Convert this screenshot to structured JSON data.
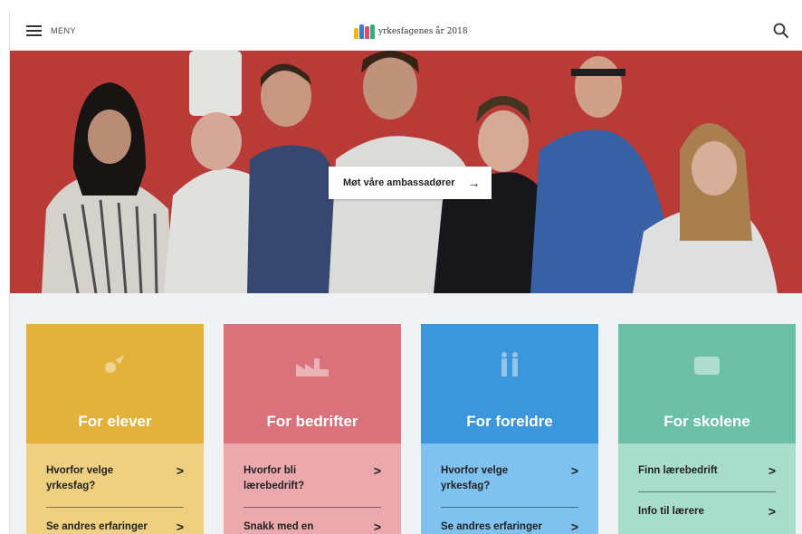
{
  "header": {
    "menu_label": "MENY",
    "logo_text": "yrkesfagenes år 2018",
    "logo_figure_colors": [
      "#f2b705",
      "#3a7bd5",
      "#e04a6b",
      "#2db37a"
    ]
  },
  "hero": {
    "background": "#c8403d",
    "cta_label": "Møt våre ambassadører",
    "cta_arrow": "→"
  },
  "cards": [
    {
      "title": "For elever",
      "icon": "elever-icon",
      "head_color": "#e3b23b",
      "body_color": "#efd080",
      "links": [
        {
          "label_lines": [
            "Hvorfor velge",
            "yrkesfag?"
          ],
          "chevron": ">"
        },
        {
          "label_lines": [
            "Se andres erfaringer"
          ],
          "chevron": ">"
        }
      ]
    },
    {
      "title": "For bedrifter",
      "icon": "factory-icon",
      "head_color": "#d9727b",
      "body_color": "#eba9ad",
      "links": [
        {
          "label_lines": [
            "Hvorfor bli",
            "lærebedrift?"
          ],
          "chevron": ">"
        },
        {
          "label_lines": [
            "Snakk med en"
          ],
          "chevron": ">"
        }
      ]
    },
    {
      "title": "For foreldre",
      "icon": "parents-icon",
      "head_color": "#3b96dc",
      "body_color": "#7fc2ef",
      "links": [
        {
          "label_lines": [
            "Hvorfor velge",
            "yrkesfag?"
          ],
          "chevron": ">"
        },
        {
          "label_lines": [
            "Se andres erfaringer"
          ],
          "chevron": ">"
        }
      ]
    },
    {
      "title": "For skolene",
      "icon": "school-icon",
      "head_color": "#6cc0a7",
      "body_color": "#a8dccb",
      "links": [
        {
          "label_lines": [
            "Finn lærebedrift"
          ],
          "chevron": ">"
        },
        {
          "label_lines": [
            "Info til lærere"
          ],
          "chevron": ">"
        }
      ]
    }
  ]
}
